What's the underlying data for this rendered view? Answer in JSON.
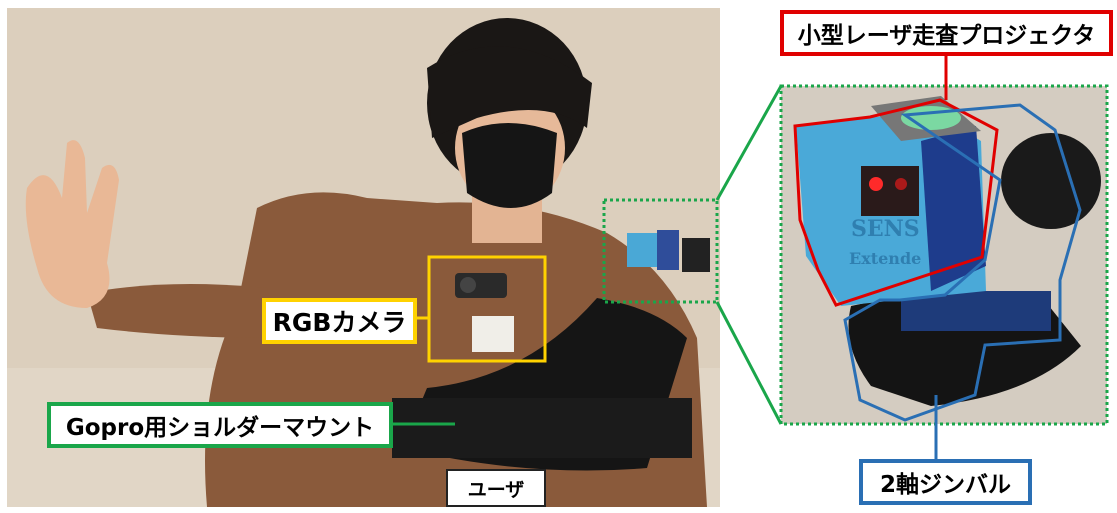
{
  "labels": {
    "projector": "小型レーザ走査プロジェクタ",
    "rgb_camera": "RGBカメラ",
    "shoulder_mount": "Gopro用ショルダーマウント",
    "user": "ユーザ",
    "gimbal": "2軸ジンバル"
  },
  "photo_text": {
    "device_print_1": "SENS",
    "device_print_2": "Extende"
  },
  "colors": {
    "projector": "#e00000",
    "rgb_camera": "#ffd200",
    "shoulder_mount": "#1aa64a",
    "gimbal": "#2a6fb4",
    "zoom_box": "#1aa64a"
  }
}
